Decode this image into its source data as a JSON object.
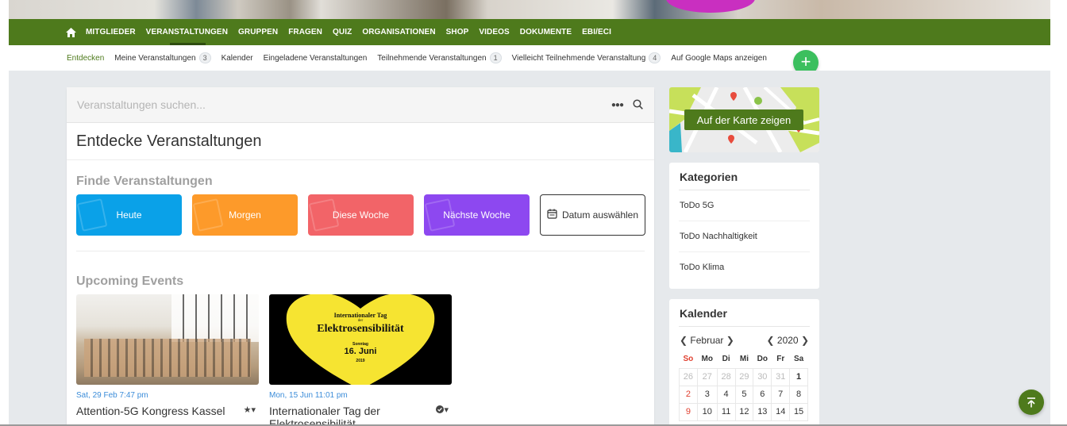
{
  "main_nav": {
    "items": [
      "MITGLIEDER",
      "VERANSTALTUNGEN",
      "GRUPPEN",
      "FRAGEN",
      "QUIZ",
      "ORGANISATIONEN",
      "SHOP",
      "VIDEOS",
      "DOKUMENTE",
      "EBI/ECI"
    ],
    "active": "VERANSTALTUNGEN"
  },
  "sub_nav": {
    "items": [
      {
        "label": "Entdecken",
        "count": null
      },
      {
        "label": "Meine Veranstaltungen",
        "count": "3"
      },
      {
        "label": "Kalender",
        "count": null
      },
      {
        "label": "Eingeladene Veranstaltungen",
        "count": null
      },
      {
        "label": "Teilnehmende Veranstaltungen",
        "count": "1"
      },
      {
        "label": "Vielleicht Teilnehmende Veranstaltung",
        "count": "4"
      },
      {
        "label": "Auf Google Maps anzeigen",
        "count": null
      }
    ],
    "add_label": "+"
  },
  "search": {
    "placeholder": "Veranstaltungen suchen..."
  },
  "main": {
    "title": "Entdecke Veranstaltungen",
    "find_title": "Finde Veranstaltungen",
    "quick_filters": {
      "heute": "Heute",
      "morgen": "Morgen",
      "diese_woche": "Diese Woche",
      "naechste_woche": "Nächste Woche",
      "datum": "Datum auswählen"
    },
    "upcoming_title": "Upcoming Events",
    "events": [
      {
        "date": "Sat, 29 Feb 7:47 pm",
        "title": "Attention-5G Kongress Kassel",
        "action_icon": "star-icon"
      },
      {
        "date": "Mon, 15 Jun 11:01 pm",
        "title": "Internationaler Tag der Elektrosensibilität",
        "action_icon": "check-circle-icon",
        "poster": {
          "line1": "Internationaler Tag",
          "line2": "der",
          "line3": "Elektrosensibilität",
          "line4": "Sonntag",
          "line5": "16. Juni",
          "line6": "2019"
        }
      }
    ]
  },
  "sidebar": {
    "map_button": "Auf der Karte zeigen",
    "categories_title": "Kategorien",
    "categories": [
      "ToDo 5G",
      "ToDo Nachhaltigkeit",
      "ToDo Klima"
    ],
    "calendar_title": "Kalender",
    "calendar": {
      "month": "Februar",
      "year": "2020",
      "weekdays": [
        "So",
        "Mo",
        "Di",
        "Mi",
        "Do",
        "Fr",
        "Sa"
      ],
      "rows": [
        [
          "26",
          "27",
          "28",
          "29",
          "30",
          "31",
          "1"
        ],
        [
          "2",
          "3",
          "4",
          "5",
          "6",
          "7",
          "8"
        ],
        [
          "9",
          "10",
          "11",
          "12",
          "13",
          "14",
          "15"
        ]
      ]
    }
  },
  "colors": {
    "brand_green": "#4e7a1c",
    "heute": "#0aa1e8",
    "morgen": "#fd9a2a",
    "diese_woche": "#f26468",
    "naechste_woche": "#8d48f0",
    "add_button": "#3bbf5e"
  }
}
